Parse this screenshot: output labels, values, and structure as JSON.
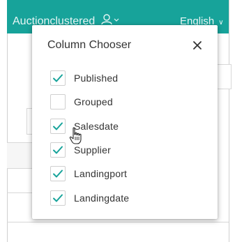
{
  "app": {
    "name": "Auctionclustered",
    "language": "English",
    "accent_color": "#17a39a"
  },
  "column_chooser": {
    "title": "Column Chooser",
    "close_icon": "close-icon",
    "check_color": "#17a39a",
    "items": [
      {
        "label": "Published",
        "checked": true
      },
      {
        "label": "Grouped",
        "checked": false
      },
      {
        "label": "Salesdate",
        "checked": true
      },
      {
        "label": "Supplier",
        "checked": true
      },
      {
        "label": "Landingport",
        "checked": true
      },
      {
        "label": "Landingdate",
        "checked": true
      }
    ]
  },
  "cursor": {
    "icon": "hand-pointer-icon"
  }
}
